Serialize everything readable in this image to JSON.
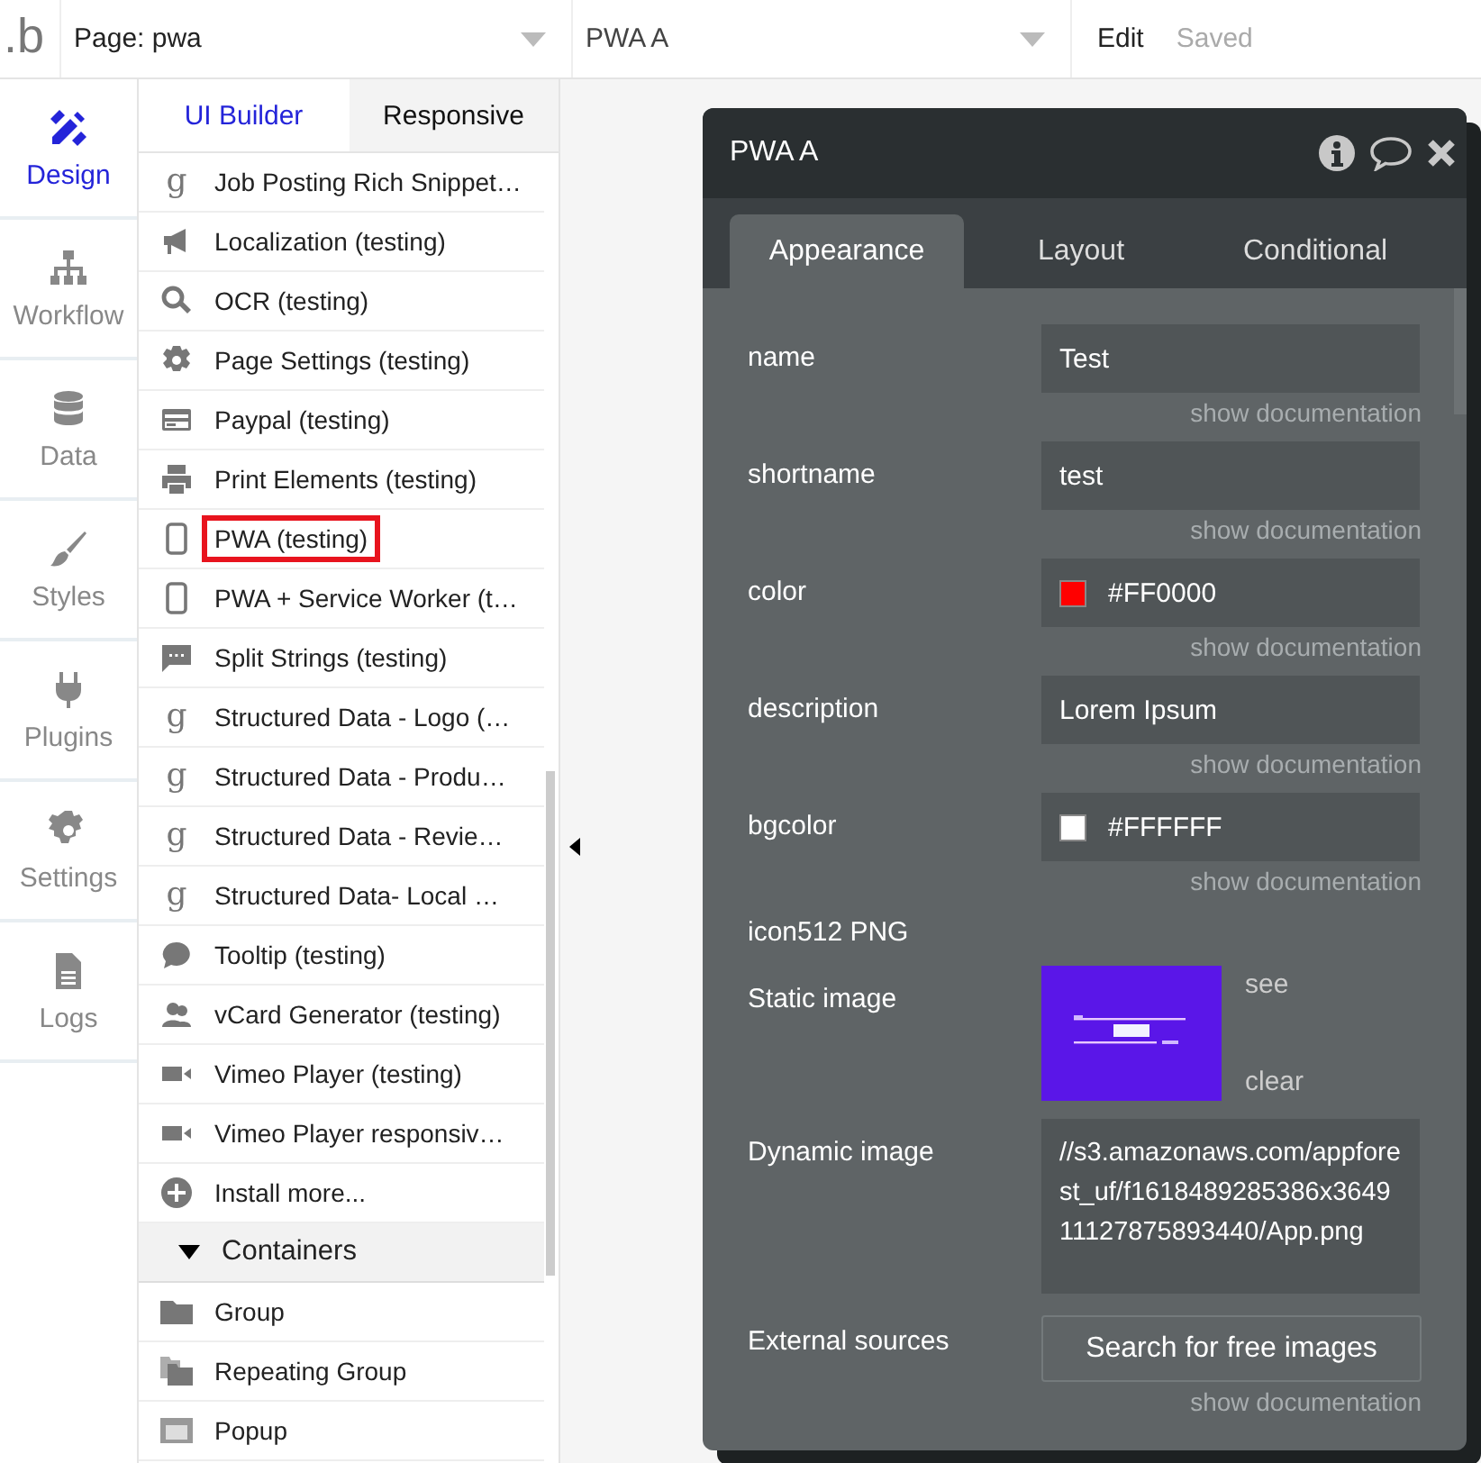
{
  "topbar": {
    "logo": ".b",
    "page_selector": "Page: pwa",
    "element_selector": "PWA A",
    "menu": "Edit",
    "status": "Saved"
  },
  "nav": [
    {
      "kind": "design",
      "label": "Design",
      "selected": true
    },
    {
      "kind": "workflow",
      "label": "Workflow",
      "selected": false
    },
    {
      "kind": "data",
      "label": "Data",
      "selected": false
    },
    {
      "kind": "styles",
      "label": "Styles",
      "selected": false
    },
    {
      "kind": "plugins",
      "label": "Plugins",
      "selected": false
    },
    {
      "kind": "settings",
      "label": "Settings",
      "selected": false
    },
    {
      "kind": "logs",
      "label": "Logs",
      "selected": false
    }
  ],
  "panel_tabs": [
    {
      "label": "UI Builder",
      "selected": true
    },
    {
      "label": "Responsive",
      "selected": false
    }
  ],
  "elements": [
    {
      "kind": "glyph",
      "glyph": "g",
      "label": "Job Posting Rich Snippet…",
      "highlighted": false
    },
    {
      "kind": "megaphone",
      "label": "Localization (testing)",
      "highlighted": false
    },
    {
      "kind": "search",
      "label": "OCR (testing)",
      "highlighted": false
    },
    {
      "kind": "gear",
      "label": "Page Settings (testing)",
      "highlighted": false
    },
    {
      "kind": "card",
      "label": "Paypal (testing)",
      "highlighted": false
    },
    {
      "kind": "printer",
      "label": "Print Elements (testing)",
      "highlighted": false
    },
    {
      "kind": "phone",
      "label": "PWA (testing)",
      "highlighted": true
    },
    {
      "kind": "phone",
      "label": "PWA + Service Worker (t…",
      "highlighted": false
    },
    {
      "kind": "chat",
      "label": "Split Strings (testing)",
      "highlighted": false
    },
    {
      "kind": "glyph",
      "glyph": "g",
      "label": "Structured Data - Logo (…",
      "highlighted": false
    },
    {
      "kind": "glyph",
      "glyph": "g",
      "label": "Structured Data - Produ…",
      "highlighted": false
    },
    {
      "kind": "glyph",
      "glyph": "g",
      "label": "Structured Data - Revie…",
      "highlighted": false
    },
    {
      "kind": "glyph",
      "glyph": "g",
      "label": "Structured Data- Local …",
      "highlighted": false
    },
    {
      "kind": "bubble",
      "label": "Tooltip (testing)",
      "highlighted": false
    },
    {
      "kind": "people",
      "label": "vCard Generator (testing)",
      "highlighted": false
    },
    {
      "kind": "video",
      "label": "Vimeo Player (testing)",
      "highlighted": false
    },
    {
      "kind": "video",
      "label": "Vimeo Player responsiv…",
      "highlighted": false
    },
    {
      "kind": "plus",
      "label": "Install more...",
      "highlighted": false
    },
    {
      "kind": "section",
      "label": "Containers",
      "expanded": true
    },
    {
      "kind": "folder",
      "label": "Group",
      "highlighted": false
    },
    {
      "kind": "folders",
      "label": "Repeating Group",
      "highlighted": false
    },
    {
      "kind": "popup",
      "label": "Popup",
      "highlighted": false
    }
  ],
  "inspector": {
    "title": "PWA A",
    "tabs": [
      {
        "label": "Appearance",
        "selected": true
      },
      {
        "label": "Layout",
        "selected": false
      },
      {
        "label": "Conditional",
        "selected": false
      }
    ],
    "fields": [
      {
        "kind": "text",
        "label": "name",
        "value": "Test",
        "doc": "show documentation"
      },
      {
        "kind": "text",
        "label": "shortname",
        "value": "test",
        "doc": "show documentation"
      },
      {
        "kind": "color",
        "label": "color",
        "value": "#FF0000",
        "color": "#ff0000",
        "doc": "show documentation"
      },
      {
        "kind": "text",
        "label": "description",
        "value": "Lorem Ipsum",
        "doc": "show documentation"
      },
      {
        "kind": "color",
        "label": "bgcolor",
        "value": "#FFFFFF",
        "color": "#ffffff",
        "doc": "show documentation"
      },
      {
        "kind": "heading",
        "label": "icon512 PNG"
      },
      {
        "label": "Static image",
        "links": [
          "see",
          "clear"
        ]
      },
      {
        "kind": "textarea",
        "label": "Dynamic image",
        "value": "//s3.amazonaws.com/appforest_uf/f1618489285386x364911127875893440/App.png"
      },
      {
        "kind": "button",
        "label": "External sources",
        "value": "Search for free images",
        "doc": "show documentation"
      }
    ]
  }
}
